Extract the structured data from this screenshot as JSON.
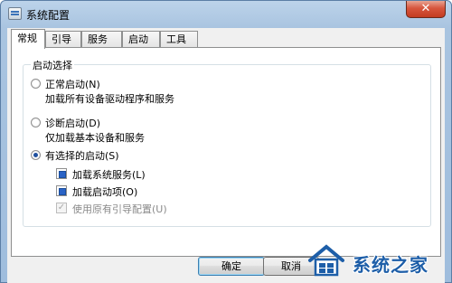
{
  "window": {
    "title": "系统配置",
    "close_glyph": "✕"
  },
  "tabs": [
    {
      "label": "常规",
      "active": true
    },
    {
      "label": "引导",
      "active": false
    },
    {
      "label": "服务",
      "active": false
    },
    {
      "label": "启动",
      "active": false
    },
    {
      "label": "工具",
      "active": false
    }
  ],
  "startup_group": {
    "title": "启动选择",
    "normal": {
      "label": "正常启动(N)",
      "desc": "加载所有设备驱动程序和服务",
      "selected": false
    },
    "diagnostic": {
      "label": "诊断启动(D)",
      "desc": "仅加载基本设备和服务",
      "selected": false
    },
    "selective": {
      "label": "有选择的启动(S)",
      "selected": true,
      "options": [
        {
          "label": "加载系统服务(L)",
          "state": "partial",
          "enabled": true
        },
        {
          "label": "加载启动项(O)",
          "state": "partial",
          "enabled": true
        },
        {
          "label": "使用原有引导配置(U)",
          "state": "checked",
          "enabled": false
        }
      ]
    }
  },
  "buttons": {
    "ok": "确定",
    "cancel": "取消"
  },
  "watermark": {
    "text": "系统之家"
  },
  "colors": {
    "accent": "#1e4f9e",
    "watermark": "#1d5ea8",
    "close": "#c33c21"
  }
}
